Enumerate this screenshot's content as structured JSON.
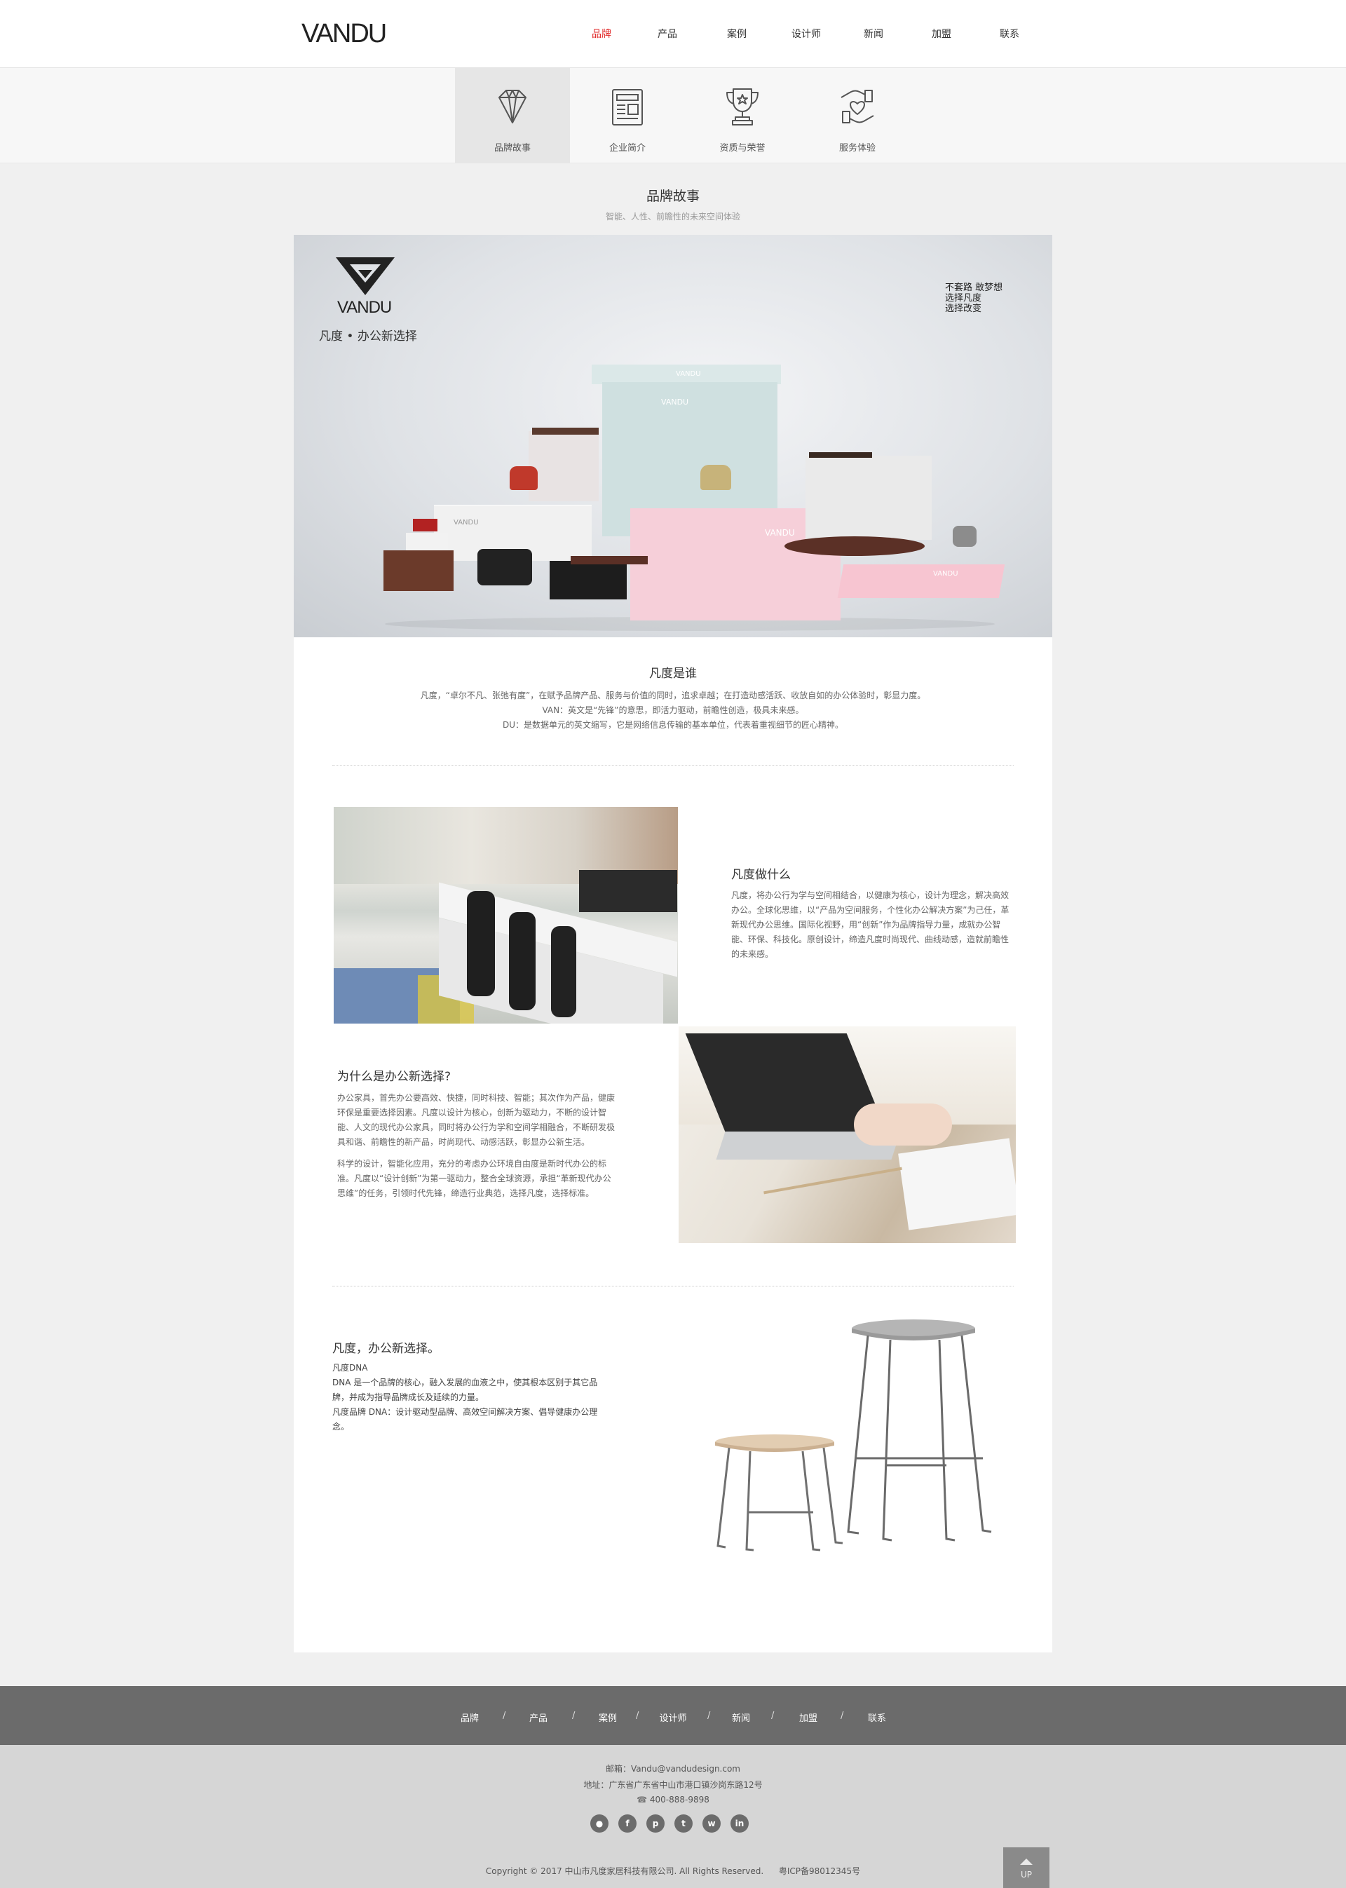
{
  "header": {
    "logo": "VANDU",
    "nav": [
      "品牌",
      "产品",
      "案例",
      "设计师",
      "新闻",
      "加盟",
      "联系"
    ],
    "active_index": 0,
    "accent_color": "#e02424"
  },
  "subnav": {
    "items": [
      {
        "label": "品牌故事",
        "icon": "diamond-icon"
      },
      {
        "label": "企业简介",
        "icon": "document-icon"
      },
      {
        "label": "资质与荣誉",
        "icon": "trophy-icon"
      },
      {
        "label": "服务体验",
        "icon": "heart-hand-icon"
      }
    ],
    "active_index": 0
  },
  "section": {
    "title": "品牌故事",
    "subtitle": "智能、人性、前瞻性的未来空间体验"
  },
  "hero": {
    "brand": "VANDU",
    "tagline": "凡度 • 办公新选择",
    "slogan": [
      "不套路 敢梦想",
      "选择凡度",
      "选择改变"
    ],
    "box_labels": [
      "VANDU",
      "VANDU",
      "VANDU",
      "VANDU",
      "VANDU"
    ]
  },
  "who": {
    "title": "凡度是谁",
    "lines": [
      "凡度，“卓尔不凡、张弛有度”，在赋予品牌产品、服务与价值的同时，追求卓越；在打造动感活跃、收放自如的办公体验时，彰显力度。",
      "VAN：英文是“先锋”的意思，即活力驱动，前瞻性创造，极具未来感。",
      "DU：是数据单元的英文缩写，它是网络信息传输的基本单位，代表着重视细节的匠心精神。"
    ]
  },
  "what": {
    "title": "凡度做什么",
    "text": "凡度，将办公行为学与空间相结合，以健康为核心，设计为理念，解决高效办公。全球化思维，以“产品为空间服务，个性化办公解决方案”为己任，革新现代办公思维。国际化视野，用“创新”作为品牌指导力量，成就办公智能、环保、科技化。原创设计，缔造凡度时尚现代、曲线动感，造就前瞻性的未来感。"
  },
  "why": {
    "title": "为什么是办公新选择?",
    "p1": "办公家具，首先办公要高效、快捷，同时科技、智能；其次作为产品，健康环保是重要选择因素。凡度以设计为核心，创新为驱动力，不断的设计智能、人文的现代办公家具，同时将办公行为学和空间学相融合，不断研发极具和谐、前瞻性的新产品，时尚现代、动感活跃，彰显办公新生活。",
    "p2": "科学的设计，智能化应用，充分的考虑办公环境自由度是新时代办公的标准。凡度以“设计创新”为第一驱动力，整合全球资源，承担“革新现代办公思维”的任务，引领时代先锋，缔造行业典范，选择凡度，选择标准。"
  },
  "dna": {
    "title": "凡度，办公新选择。",
    "lines": [
      "凡度DNA",
      "DNA 是一个品牌的核心，融入发展的血液之中，使其根本区别于其它品牌，并成为指导品牌成长及延续的力量。",
      "凡度品牌 DNA：设计驱动型品牌、高效空间解决方案、倡导健康办公理念。"
    ]
  },
  "footer": {
    "nav": [
      "品牌",
      "产品",
      "案例",
      "设计师",
      "新闻",
      "加盟",
      "联系"
    ],
    "separator": "/",
    "email": "邮箱：Vandu@vandudesign.com",
    "address": "地址：广东省广东省中山市港口镇沙岗东路12号",
    "phone": "400-888-9898",
    "social": [
      "wechat-icon",
      "facebook-icon",
      "pinterest-icon",
      "twitter-icon",
      "weibo-icon",
      "linkedin-icon"
    ],
    "copyright": "Copyright © 2017 中山市凡度家居科技有限公司. All Rights Reserved.",
    "icp": "粤ICP备98012345号",
    "up_label": "UP"
  }
}
